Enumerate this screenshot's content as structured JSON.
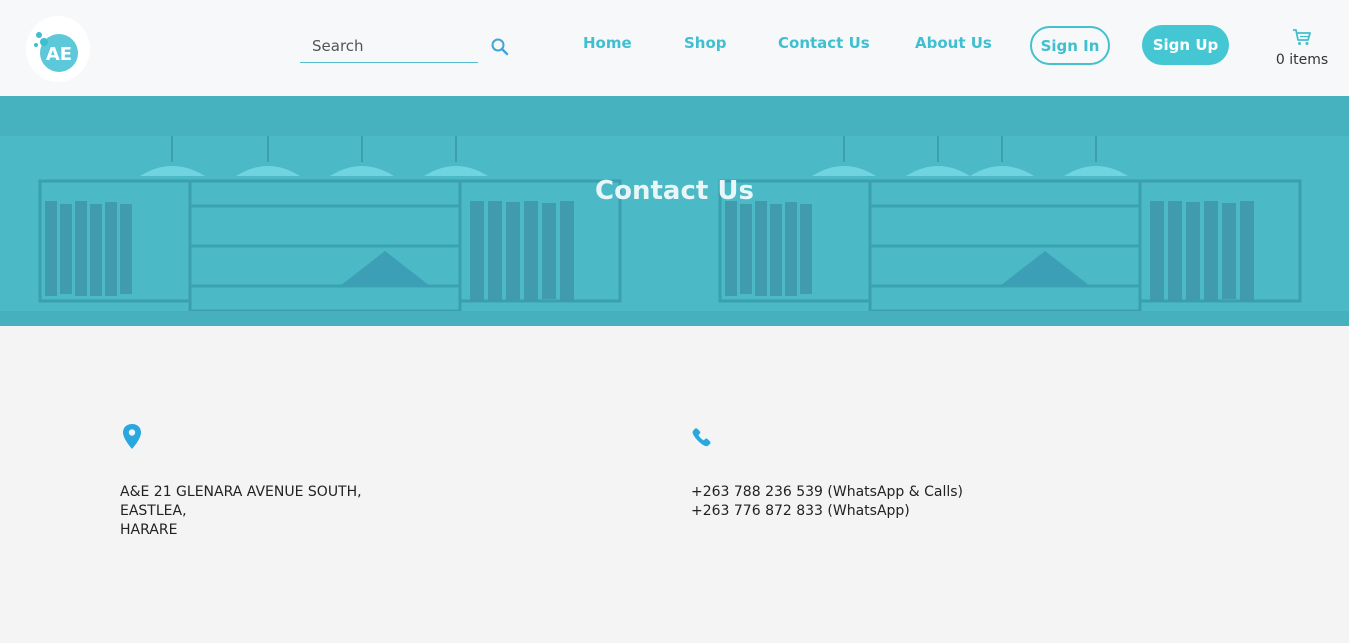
{
  "header": {
    "logo_text": "AE",
    "search": {
      "placeholder": "Search",
      "value": ""
    },
    "nav": [
      {
        "label": "Home"
      },
      {
        "label": "Shop"
      },
      {
        "label": "Contact Us"
      },
      {
        "label": "About Us"
      }
    ],
    "sign_in_label": "Sign In",
    "sign_up_label": "Sign Up",
    "cart": {
      "count_label": "0 items"
    }
  },
  "banner": {
    "title": "Contact Us"
  },
  "contact": {
    "address": {
      "icon": "map-marker-icon",
      "lines": [
        "A&E 21 GLENARA AVENUE SOUTH,",
        "EASTLEA,",
        "HARARE"
      ]
    },
    "phone": {
      "icon": "phone-icon",
      "lines": [
        "+263 788 236 539 (WhatsApp & Calls)",
        "+263 776 872 833 (WhatsApp)"
      ]
    }
  },
  "colors": {
    "accent": "#45c6d3",
    "nav_text": "#3fbfcf",
    "icon_blue": "#29a8e0",
    "page_bg": "#f4f4f4",
    "header_bg": "#f6f8fa"
  }
}
